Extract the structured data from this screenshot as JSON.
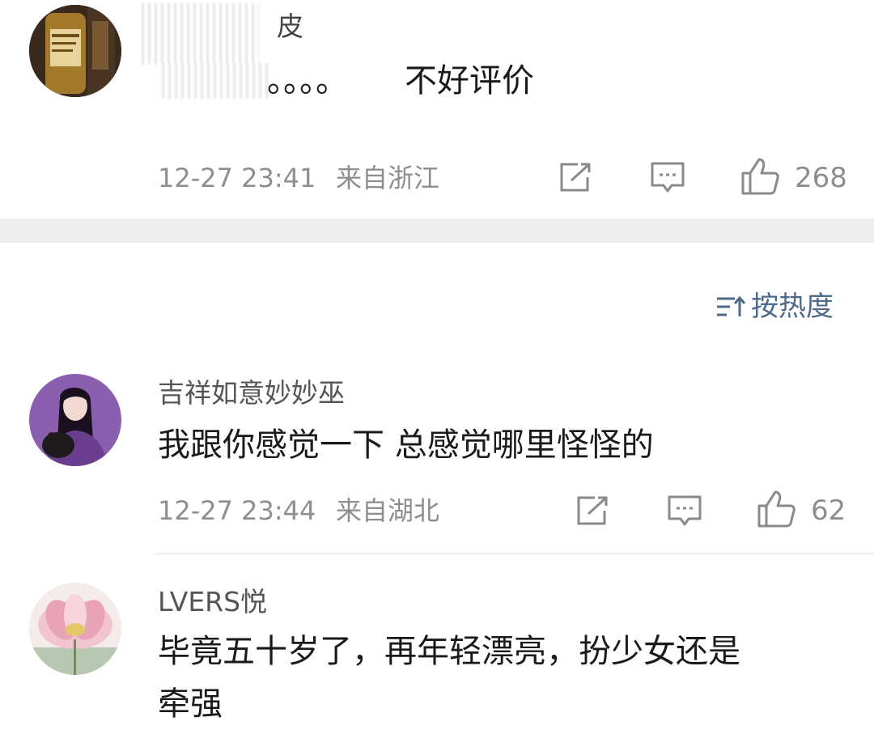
{
  "comments": [
    {
      "username": "皮",
      "text": "不好评价",
      "obscured_prefix": "。。。。",
      "time": "12-27 23:41",
      "location": "来自浙江",
      "likes": "268"
    },
    {
      "username": "吉祥如意妙妙巫",
      "text": "我跟你感觉一下 总感觉哪里怪怪的",
      "time": "12-27 23:44",
      "location": "来自湖北",
      "likes": "62"
    },
    {
      "username": "LVERS悦",
      "text_line1": "毕竟五十岁了，再年轻漂亮，扮少女还是",
      "text_line2": "牵强"
    }
  ],
  "sort": {
    "label": "按热度",
    "icon": "sort-icon"
  },
  "icons": {
    "share": "share-icon",
    "reply": "comment-icon",
    "like": "thumbs-up-icon"
  },
  "colors": {
    "accent": "#4d6a8a",
    "meta": "#8e8e8e",
    "divider": "#eeeeee"
  }
}
